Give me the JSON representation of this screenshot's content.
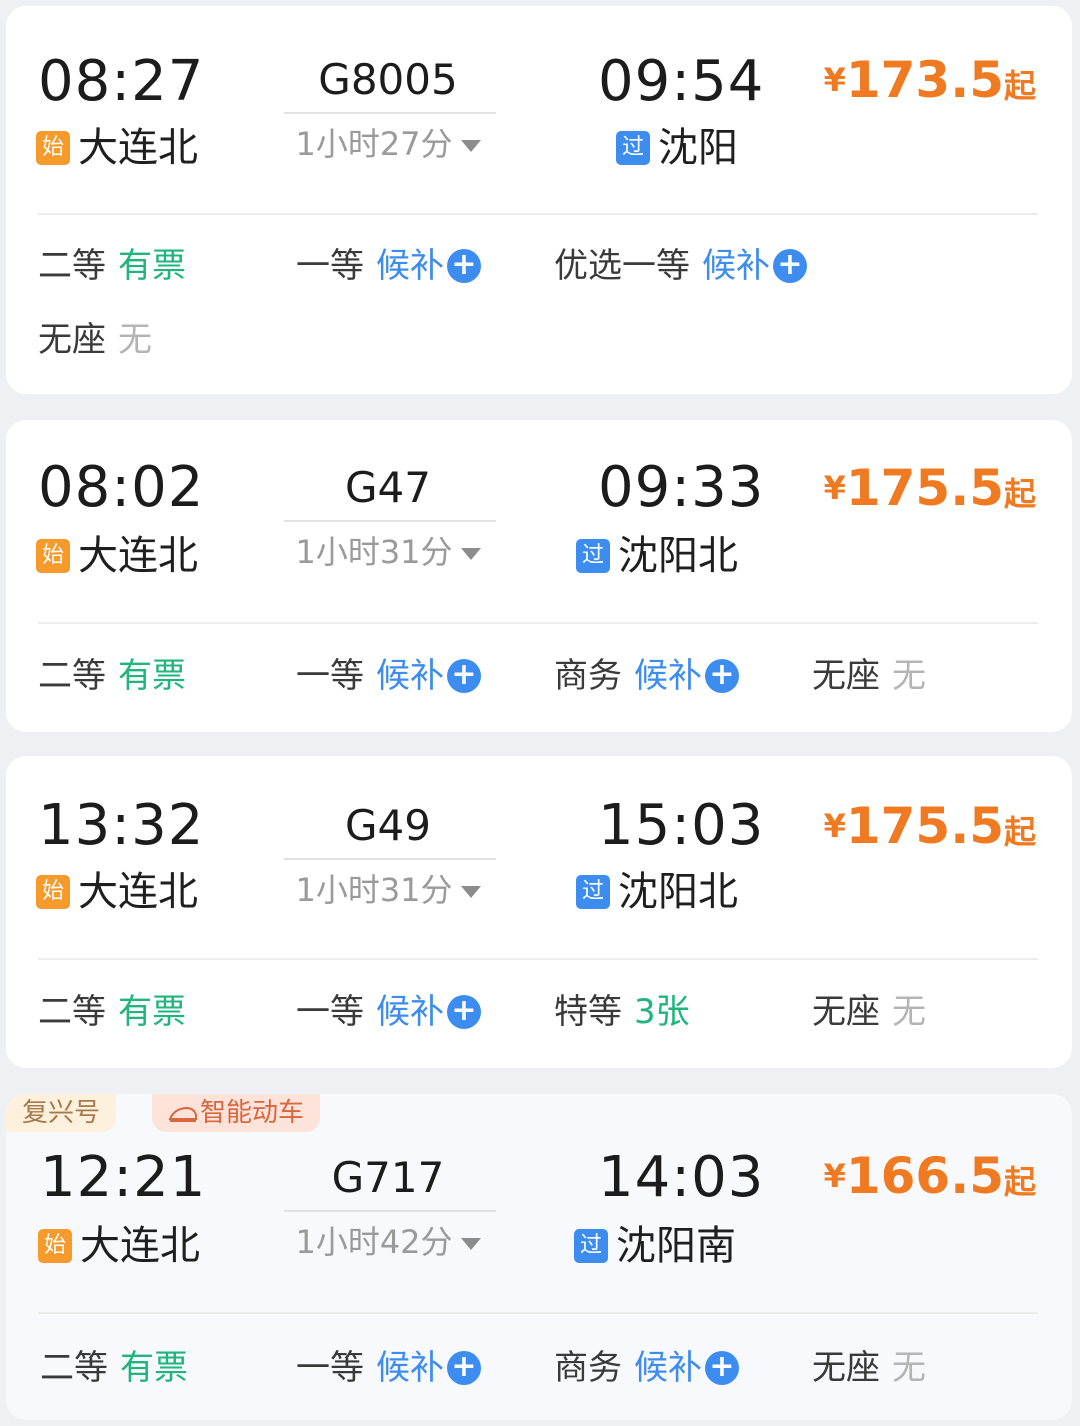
{
  "trains": [
    {
      "dep_time": "08:27",
      "dep_station": "大连北",
      "dep_tag": "始",
      "number": "G8005",
      "duration": "1小时27分",
      "arr_time": "09:54",
      "arr_station": "沈阳",
      "arr_tag": "过",
      "price_symbol": "¥",
      "price": "173.5",
      "price_suffix": "起",
      "seats": [
        {
          "class": "二等",
          "status": "有票",
          "color": "green",
          "plus": false
        },
        {
          "class": "一等",
          "status": "候补",
          "color": "blue",
          "plus": true
        },
        {
          "class": "优选一等",
          "status": "候补",
          "color": "blue",
          "plus": true
        },
        {
          "class": "无座",
          "status": "无",
          "color": "gray",
          "plus": false
        }
      ]
    },
    {
      "dep_time": "08:02",
      "dep_station": "大连北",
      "dep_tag": "始",
      "number": "G47",
      "duration": "1小时31分",
      "arr_time": "09:33",
      "arr_station": "沈阳北",
      "arr_tag": "过",
      "price_symbol": "¥",
      "price": "175.5",
      "price_suffix": "起",
      "seats": [
        {
          "class": "二等",
          "status": "有票",
          "color": "green",
          "plus": false
        },
        {
          "class": "一等",
          "status": "候补",
          "color": "blue",
          "plus": true
        },
        {
          "class": "商务",
          "status": "候补",
          "color": "blue",
          "plus": true
        },
        {
          "class": "无座",
          "status": "无",
          "color": "gray",
          "plus": false
        }
      ]
    },
    {
      "dep_time": "13:32",
      "dep_station": "大连北",
      "dep_tag": "始",
      "number": "G49",
      "duration": "1小时31分",
      "arr_time": "15:03",
      "arr_station": "沈阳北",
      "arr_tag": "过",
      "price_symbol": "¥",
      "price": "175.5",
      "price_suffix": "起",
      "seats": [
        {
          "class": "二等",
          "status": "有票",
          "color": "green",
          "plus": false
        },
        {
          "class": "一等",
          "status": "候补",
          "color": "blue",
          "plus": true
        },
        {
          "class": "特等",
          "status": "3张",
          "color": "green",
          "plus": false
        },
        {
          "class": "无座",
          "status": "无",
          "color": "gray",
          "plus": false
        }
      ]
    },
    {
      "badges": [
        "复兴号",
        "智能动车"
      ],
      "dep_time": "12:21",
      "dep_station": "大连北",
      "dep_tag": "始",
      "number": "G717",
      "duration": "1小时42分",
      "arr_time": "14:03",
      "arr_station": "沈阳南",
      "arr_tag": "过",
      "price_symbol": "¥",
      "price": "166.5",
      "price_suffix": "起",
      "seats": [
        {
          "class": "二等",
          "status": "有票",
          "color": "green",
          "plus": false
        },
        {
          "class": "一等",
          "status": "候补",
          "color": "blue",
          "plus": true
        },
        {
          "class": "商务",
          "status": "候补",
          "color": "blue",
          "plus": true
        },
        {
          "class": "无座",
          "status": "无",
          "color": "gray",
          "plus": false
        }
      ]
    }
  ],
  "icons": {
    "dropdown": "caret-down-icon",
    "add": "plus-circle-icon",
    "train": "train-icon"
  },
  "colors": {
    "price": "#f07a22",
    "available": "#1fb57c",
    "waitlist": "#3d8cf0",
    "start_tag": "#f59a2b",
    "pass_tag": "#3d8cf0"
  }
}
